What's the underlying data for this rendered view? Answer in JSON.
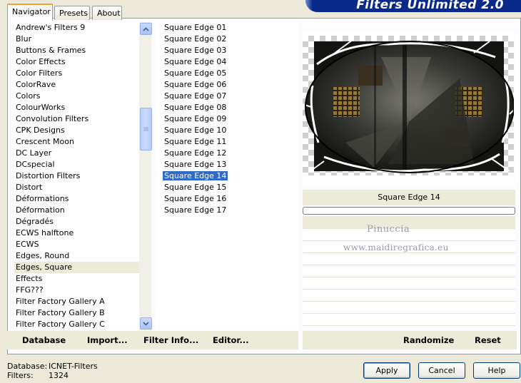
{
  "app": {
    "title": "Filters Unlimited 2.0"
  },
  "tabs": [
    {
      "label": "Navigator",
      "active": true
    },
    {
      "label": "Presets",
      "active": false
    },
    {
      "label": "About",
      "active": false
    }
  ],
  "categories": {
    "items": [
      "Andrew's Filters 9",
      "Blur",
      "Buttons & Frames",
      "Color Effects",
      "Color Filters",
      "ColorRave",
      "Colors",
      "ColourWorks",
      "Convolution Filters",
      "CPK Designs",
      "Crescent Moon",
      "DC Layer",
      "DCspecial",
      "Distortion Filters",
      "Distort",
      "Déformations",
      "Déformation",
      "Dégradés",
      "ECWS halftone",
      "ECWS",
      "Edges, Round",
      "Edges, Square",
      "Effects",
      "FFG???",
      "Filter Factory Gallery A",
      "Filter Factory Gallery B",
      "Filter Factory Gallery C"
    ],
    "selected": "Edges, Square"
  },
  "filters": {
    "items": [
      "Square Edge 01",
      "Square Edge 02",
      "Square Edge 03",
      "Square Edge 04",
      "Square Edge 05",
      "Square Edge 06",
      "Square Edge 07",
      "Square Edge 08",
      "Square Edge 09",
      "Square Edge 10",
      "Square Edge 11",
      "Square Edge 12",
      "Square Edge 13",
      "Square Edge 14",
      "Square Edge 15",
      "Square Edge 16",
      "Square Edge 17"
    ],
    "selected": "Square Edge 14"
  },
  "preview": {
    "filter_name": "Square Edge 14",
    "watermark_line1": "Pinuccia",
    "watermark_line2": "www.maidiregrafica.eu"
  },
  "toolbar_left": {
    "database": "Database",
    "import": "Import...",
    "filter_info": "Filter Info...",
    "editor": "Editor..."
  },
  "toolbar_right": {
    "randomize": "Randomize",
    "reset": "Reset"
  },
  "status": {
    "database_label": "Database:",
    "database_value": "ICNET-Filters",
    "filters_label": "Filters:",
    "filters_value": "1324"
  },
  "buttons": {
    "apply": "Apply",
    "cancel": "Cancel",
    "help": "Help"
  },
  "colors": {
    "selection": "#316ac5",
    "banner": "#0a2a8a",
    "dialog_bg": "#ece9d8"
  }
}
